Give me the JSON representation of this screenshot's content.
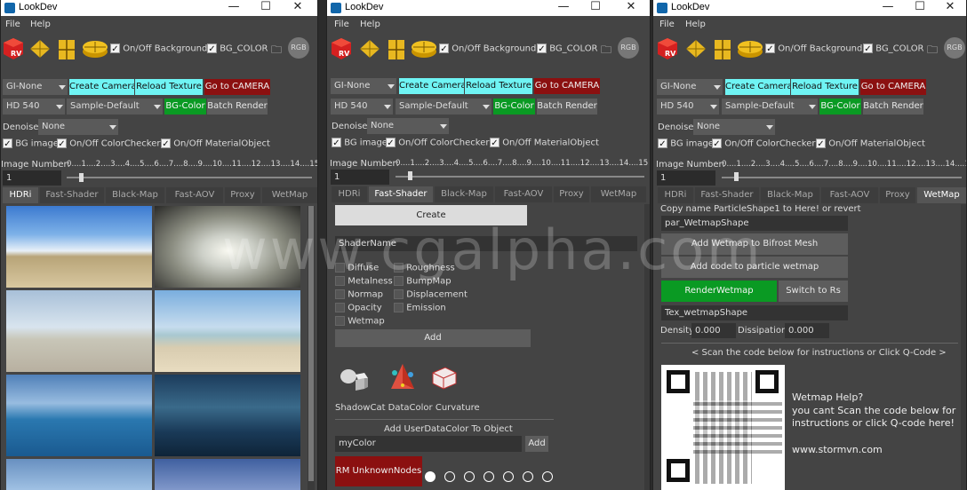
{
  "windows": [
    {
      "title": "LookDev",
      "menu": [
        "File",
        "Help"
      ],
      "tabs": [
        "HDRi",
        "Fast-Shader",
        "Black-Map",
        "Fast-AOV",
        "Proxy",
        "WetMap"
      ],
      "active_tab": 0
    },
    {
      "title": "LookDev",
      "menu": [
        "File",
        "Help"
      ],
      "tabs": [
        "HDRi",
        "Fast-Shader",
        "Black-Map",
        "Fast-AOV",
        "Proxy",
        "WetMap"
      ],
      "active_tab": 1
    },
    {
      "title": "LookDev",
      "menu": [
        "File",
        "Help"
      ],
      "tabs": [
        "HDRi",
        "Fast-Shader",
        "Black-Map",
        "Fast-AOV",
        "Proxy",
        "WetMap"
      ],
      "active_tab": 5
    }
  ],
  "toolbar": {
    "rv": "RV",
    "bg_toggle": "On/Off Background",
    "bg_color": "BG_COLOR",
    "rgb": "RGB"
  },
  "controls": {
    "gi": "GI-None",
    "create_camera": "Create Camera",
    "reload_texture": "Reload Texture",
    "goto_camera": "Go to CAMERA",
    "hd": "HD 540",
    "sample": "Sample-Default",
    "bg_color_btn": "BG-Color",
    "batch_render": "Batch Render",
    "denoise_label": "Denoise",
    "denoise_value": "None",
    "bg_image": "BG image",
    "colorchecker": "On/Off ColorChecker",
    "materialobject": "On/Off MaterialObject",
    "image_number": "Image Number:",
    "ticks": "0....1....2....3....4....5....6....7....8....9....10....11....12....13....14....15",
    "image_value": "1"
  },
  "fastshader": {
    "create": "Create",
    "shadername": "ShaderName",
    "left_checks": [
      "Diffuse",
      "Metalness",
      "Normap",
      "Opacity",
      "Wetmap"
    ],
    "right_checks": [
      "Roughness",
      "BumpMap",
      "Displacement",
      "Emission"
    ],
    "add": "Add",
    "icons_label": "ShadowCat DataColor Curvature",
    "userdata": "Add UserDataColor To Object",
    "mycolor": "myColor",
    "add2": "Add",
    "rm_unknown": "RM UnknownNodes"
  },
  "wetmap": {
    "copy_name": "Copy name ParticleShape1 to Here! or revert",
    "particle_field": "par_WetmapShape",
    "add_wetmap": "Add Wetmap to Bifrost Mesh",
    "add_code": "Add code to particle wetmap",
    "render_wetmap": "RenderWetmap",
    "switch_rs": "Switch to Rs",
    "tex_field": "Tex_wetmapShape",
    "density_label": "Density",
    "density_value": "0.000",
    "dissipation_label": "Dissipation",
    "dissipation_value": "0.000",
    "scan_note": "< Scan the code below for instructions or Click Q-Code >",
    "help_title": "Wetmap Help?",
    "help_text1": "you cant Scan the code below for",
    "help_text2": "instructions or click Q-code here!",
    "help_url": "www.stormvn.com"
  },
  "watermark": "www.cgalpha.com",
  "carousel": {
    "count": 7,
    "active_index": 0
  },
  "colors": {
    "cyan": "#6ff4f4",
    "red": "#8b1010",
    "green": "#0a9a23",
    "panel": "#444444"
  }
}
